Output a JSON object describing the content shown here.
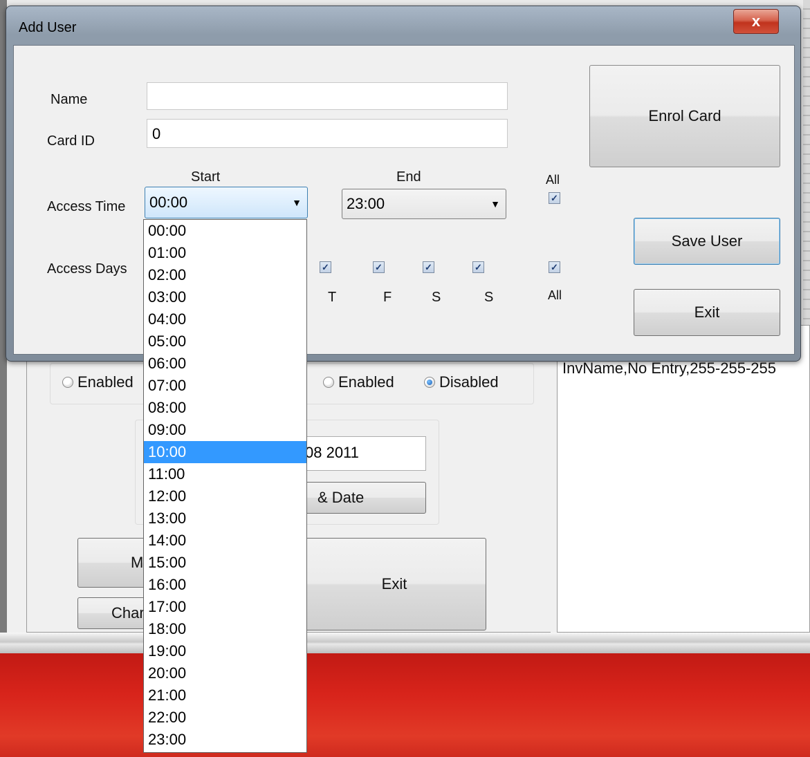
{
  "background_window": {
    "radio_group_1": {
      "enabled_label": "Enabled"
    },
    "radio_group_2": {
      "enabled_label": "Enabled",
      "disabled_label": "Disabled",
      "selected": "Disabled"
    },
    "date_field_partial": "08 2011",
    "set_date_button_partial": "& Date",
    "left_button_1_partial": "M",
    "left_button_2_partial": "Char",
    "exit_button": "Exit",
    "log_line": "InvName,No Entry,255-255-255"
  },
  "dialog": {
    "title": "Add User",
    "close_glyph": "x",
    "name_label": "Name",
    "name_value": "",
    "card_id_label": "Card ID",
    "card_id_value": "0",
    "start_label": "Start",
    "end_label": "End",
    "all_time_label": "All",
    "access_time_label": "Access Time",
    "start_value": "00:00",
    "end_value": "23:00",
    "access_days_label": "Access Days",
    "day_labels": [
      "T",
      "F",
      "S",
      "S"
    ],
    "all_days_label": "All",
    "enrol_card_button": "Enrol Card",
    "save_user_button": "Save User",
    "exit_button": "Exit"
  },
  "dropdown": {
    "selected": "10:00",
    "options": [
      "00:00",
      "01:00",
      "02:00",
      "03:00",
      "04:00",
      "05:00",
      "06:00",
      "07:00",
      "08:00",
      "09:00",
      "10:00",
      "11:00",
      "12:00",
      "13:00",
      "14:00",
      "15:00",
      "16:00",
      "17:00",
      "18:00",
      "19:00",
      "20:00",
      "21:00",
      "22:00",
      "23:00"
    ]
  },
  "icons": {
    "dropdown_arrow": "triangle-down-icon",
    "check": "checkmark-icon"
  },
  "colors": {
    "selection": "#3399ff",
    "banner_red": "#d8241b"
  }
}
